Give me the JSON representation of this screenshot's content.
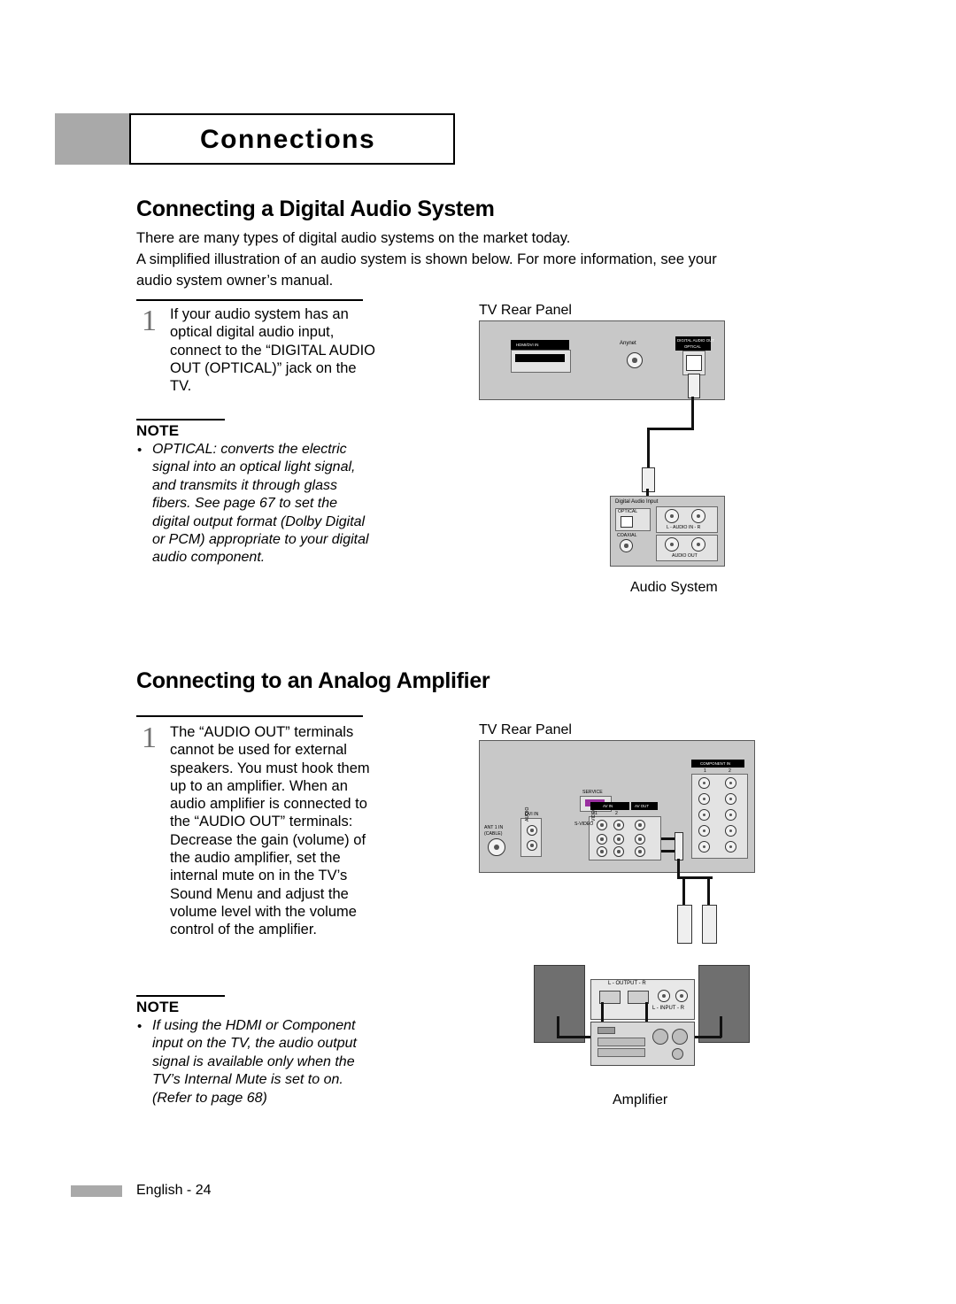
{
  "header": {
    "title": "Connections"
  },
  "sections": {
    "digital": {
      "heading": "Connecting a Digital Audio System",
      "intro_1": "There are many types of digital audio systems on the market today.",
      "intro_2": "A simplified illustration of an audio system is shown below. For more information, see your audio system owner’s manual.",
      "step_number": "1",
      "step_text": "If your audio system has an optical digital audio input, connect to the “DIGITAL AUDIO OUT (OPTICAL)” jack on the TV.",
      "note_label": "NOTE",
      "note_bullet": "•",
      "note_text": "OPTICAL: converts the electric signal into an optical light signal, and transmits it through glass fibers. See page 67 to set the digital output format (Dolby Digital or PCM) appropriate to your digital audio component.",
      "caption_tv": "TV Rear Panel",
      "caption_device": "Audio System",
      "panel_labels": {
        "hdmi": "HDMI/DVI IN",
        "anynet": "Anynet",
        "digital_audio_out": "DIGITAL AUDIO OUT",
        "optical_white": "OPTICAL",
        "device_title": "Digital Audio Input",
        "optical": "OPTICAL",
        "coaxial": "COAXIAL",
        "audio_in": "L - AUDIO IN - R",
        "audio_out": "AUDIO OUT"
      }
    },
    "analog": {
      "heading": "Connecting to an Analog Amplifier",
      "step_number": "1",
      "step_text": "The “AUDIO OUT” terminals cannot be used for external speakers. You must hook them up to an amplifier. When an audio amplifier is connected to the “AUDIO OUT” terminals: Decrease the gain (volume) of the audio amplifier, set the internal mute on in the TV’s Sound Menu and adjust the volume level with the volume control of the amplifier.",
      "note_label": "NOTE",
      "note_bullet": "•",
      "note_text": "If using the HDMI or Component input on the TV, the audio output signal is available only when the TV’s Internal Mute is set to on. (Refer to page 68)",
      "caption_tv": "TV Rear Panel",
      "caption_device": "Amplifier",
      "panel_labels": {
        "service": "SERVICE",
        "dvi_in": "DVI IN",
        "ant_in": "ANT 1 IN",
        "cable": "(CABLE)",
        "av_in": "AV IN",
        "av_out": "AV OUT",
        "component_in": "COMPONENT IN",
        "comp_1": "1",
        "comp_2": "2",
        "avin_1": "1",
        "avin_2": "2",
        "audio": "AUDIO",
        "video": "VIDEO",
        "svideo": "S-VIDEO",
        "amp_out": "L - OUTPUT - R",
        "amp_in": "L - INPUT - R"
      }
    }
  },
  "footer": {
    "text": "English - 24"
  }
}
